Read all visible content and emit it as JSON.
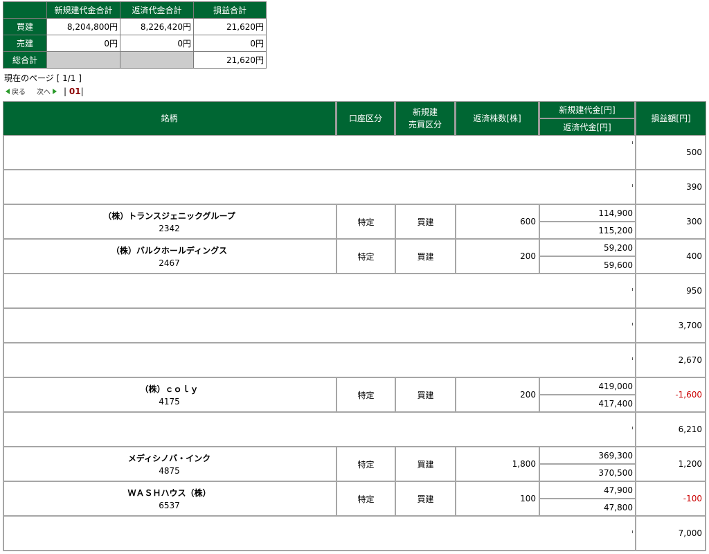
{
  "summary": {
    "headers": [
      "新規建代金合計",
      "返済代金合計",
      "損益合計"
    ],
    "rows": [
      {
        "label": "買建",
        "new": "8,204,800円",
        "repay": "8,226,420円",
        "pl": "21,620円"
      },
      {
        "label": "売建",
        "new": "0円",
        "repay": "0円",
        "pl": "0円"
      },
      {
        "label": "総合計",
        "new": "",
        "repay": "",
        "pl": "21,620円"
      }
    ]
  },
  "pager": {
    "current": "現在のページ [ 1/1 ]",
    "back": "戻る",
    "next": "次へ",
    "page_prefix": "|",
    "page_num": "01",
    "page_suffix": "|"
  },
  "table": {
    "headers": {
      "name": "銘柄",
      "account": "口座区分",
      "side_line1": "新規建",
      "side_line2": "売買区分",
      "qty": "返済株数[株]",
      "new_amount": "新規建代金[円]",
      "repay_amount": "返済代金[円]",
      "pl": "損益額[円]"
    },
    "rows": [
      {
        "pl": "500",
        "blank": true
      },
      {
        "pl": "390",
        "blank": true
      },
      {
        "name": "（株）トランスジェニックグループ",
        "code": "2342",
        "account": "特定",
        "side": "買建",
        "qty": "600",
        "new": "114,900",
        "repay": "115,200",
        "pl": "300"
      },
      {
        "name": "（株）バルクホールディングス",
        "code": "2467",
        "account": "特定",
        "side": "買建",
        "qty": "200",
        "new": "59,200",
        "repay": "59,600",
        "pl": "400"
      },
      {
        "pl": "950",
        "blank": true
      },
      {
        "pl": "3,700",
        "blank": true
      },
      {
        "pl": "2,670",
        "blank": true
      },
      {
        "name": "（株）ｃｏｌｙ",
        "code": "4175",
        "account": "特定",
        "side": "買建",
        "qty": "200",
        "new": "419,000",
        "repay": "417,400",
        "pl": "-1,600"
      },
      {
        "pl": "6,210",
        "blank": true
      },
      {
        "name": "メディシノバ・インク",
        "code": "4875",
        "account": "特定",
        "side": "買建",
        "qty": "1,800",
        "new": "369,300",
        "repay": "370,500",
        "pl": "1,200"
      },
      {
        "name": "ＷＡＳＨハウス（株）",
        "code": "6537",
        "account": "特定",
        "side": "買建",
        "qty": "100",
        "new": "47,900",
        "repay": "47,800",
        "pl": "-100"
      },
      {
        "pl": "7,000",
        "blank": true
      }
    ]
  },
  "colors": {
    "header_green": "#006633",
    "negative": "#cc0000",
    "page_num": "#8b0000"
  }
}
